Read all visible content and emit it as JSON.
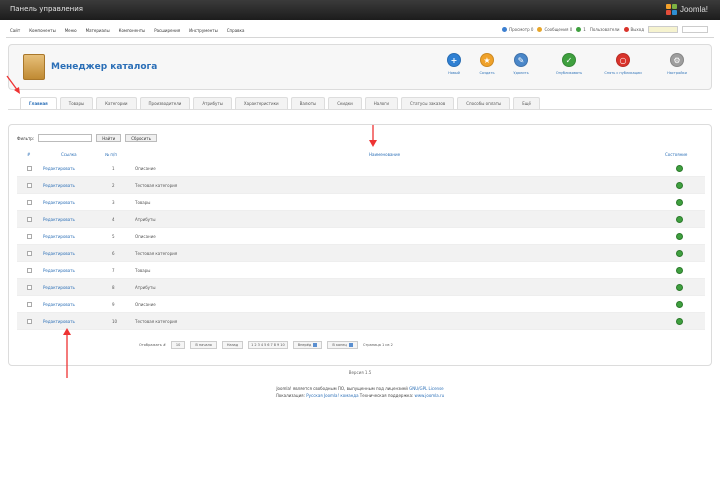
{
  "header": {
    "title": "Панель управления",
    "logo_text": "Joomla!"
  },
  "menubar": {
    "items": [
      "Сайт",
      "Компоненты",
      "Меню",
      "Материалы",
      "Компоненты",
      "Расширения",
      "Инструменты",
      "Справка"
    ],
    "right": {
      "preview": "Просмотр 0",
      "messages": "Сообщения 0",
      "users": "1",
      "users_online": "Пользователи",
      "logout": "Выход"
    },
    "colors": {
      "preview": "#3c7fd0",
      "messages": "#e7a52a",
      "users": "#3fa03f",
      "logout": "#d9332b"
    }
  },
  "toolbar": {
    "page_title": "Менеджер каталога",
    "buttons": [
      {
        "label": "Новый",
        "icon": "plus-icon",
        "color": "#2f80d3",
        "glyph": "+"
      },
      {
        "label": "Создать",
        "icon": "star-icon",
        "color": "#f0a22a",
        "glyph": "★"
      },
      {
        "label": "Удалить",
        "icon": "delete-icon",
        "color": "#4a87c9",
        "glyph": "✎"
      },
      {
        "label": "Опубликовать",
        "icon": "check-icon",
        "color": "#3fa03f",
        "glyph": "✓"
      },
      {
        "label": "Снять с публикации",
        "icon": "block-icon",
        "color": "#d9332b",
        "glyph": "○"
      },
      {
        "label": "Настройки",
        "icon": "settings-icon",
        "color": "#9e9e9e",
        "glyph": "⚙"
      }
    ]
  },
  "tabs": [
    "Главная",
    "Товары",
    "Категории",
    "Производители",
    "Атрибуты",
    "Характеристики",
    "Валюты",
    "Скидки",
    "Налоги",
    "Статусы заказов",
    "Способы оплаты",
    "Ещё"
  ],
  "filter": {
    "label": "Фильтр:",
    "go": "Найти",
    "reset": "Сбросить"
  },
  "table": {
    "headers": {
      "check": "#",
      "title": "Ссылка",
      "num": "№ п/п",
      "desc": "Наименование",
      "status": "Состояние"
    },
    "rows": [
      {
        "link": "Редактировать",
        "num": "1",
        "desc": "Описание"
      },
      {
        "link": "Редактировать",
        "num": "2",
        "desc": "Тестовая категория"
      },
      {
        "link": "Редактировать",
        "num": "3",
        "desc": "Товары"
      },
      {
        "link": "Редактировать",
        "num": "4",
        "desc": "Атрибуты"
      },
      {
        "link": "Редактировать",
        "num": "5",
        "desc": "Описание"
      },
      {
        "link": "Редактировать",
        "num": "6",
        "desc": "Тестовая категория"
      },
      {
        "link": "Редактировать",
        "num": "7",
        "desc": "Товары"
      },
      {
        "link": "Редактировать",
        "num": "8",
        "desc": "Атрибуты"
      },
      {
        "link": "Редактировать",
        "num": "9",
        "desc": "Описание"
      },
      {
        "link": "Редактировать",
        "num": "10",
        "desc": "Тестовая категория"
      }
    ]
  },
  "pager": {
    "display_label": "Отображать #",
    "display_value": "10",
    "start": "В начало",
    "prev": "Назад",
    "pages": [
      "1",
      "2",
      "3",
      "4",
      "5",
      "6",
      "7",
      "8",
      "9",
      "10"
    ],
    "next": "Вперёд",
    "end": "В конец",
    "page_info": "Страница 1 из 2"
  },
  "version": "Версия 1.5",
  "footer": {
    "line1": "Joomla! является свободным ПО, выпущенным под лицензией",
    "license": "GNU/GPL License",
    "line2": "Локализация:",
    "loc_link": "Русская Joomla! команда",
    "line3": "Техническая поддержка:",
    "support_link": "www.joomla.ru"
  }
}
